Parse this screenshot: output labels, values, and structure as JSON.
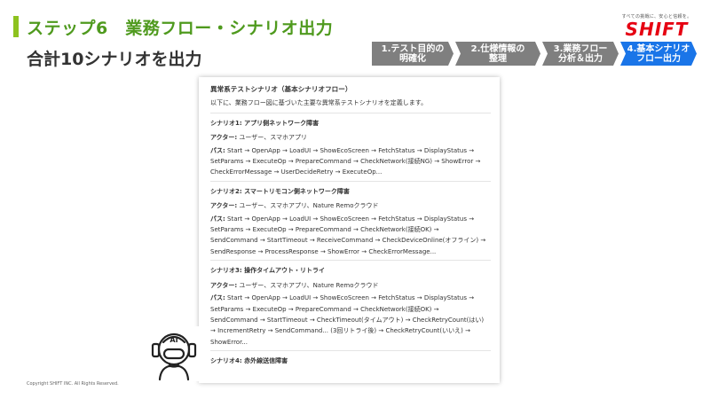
{
  "header": {
    "title": "ステップ6　業務フロー・シナリオ出力",
    "subtitle": "合計10シナリオを出力"
  },
  "logo": {
    "tagline": "すべての挑戦に、安心と信頼を。",
    "wordmark": "SHIFT"
  },
  "steps": [
    {
      "label": "1.テスト目的の\n明確化",
      "active": false
    },
    {
      "label": "2.仕様情報の\n整理",
      "active": false
    },
    {
      "label": "3.業務フロー\n分析＆出力",
      "active": false
    },
    {
      "label": "4.基本シナリオ\nフロー出力",
      "active": true
    }
  ],
  "colors": {
    "title_green": "#4f9a1e",
    "accent_green": "#8dc21f",
    "step_gray": "#7f7f7f",
    "step_active_blue": "#1a75e8",
    "logo_red": "#e60012"
  },
  "document": {
    "title": "異常系テストシナリオ（基本シナリオフロー）",
    "intro": "以下に、業務フロー図に基づいた主要な異常系テストシナリオを定義します。",
    "actor_label": "アクター:",
    "path_label": "パス:",
    "scenarios": [
      {
        "title": "シナリオ1: アプリ側ネットワーク障害",
        "actors": "ユーザー、スマホアプリ",
        "path": "Start → OpenApp → LoadUI → ShowEcoScreen → FetchStatus → DisplayStatus → SetParams → ExecuteOp → PrepareCommand → CheckNetwork(接続NG) → ShowError → CheckErrorMessage → UserDecideRetry → ExecuteOp..."
      },
      {
        "title": "シナリオ2: スマートリモコン側ネットワーク障害",
        "actors": "ユーザー、スマホアプリ、Nature Remoクラウド",
        "path": "Start → OpenApp → LoadUI → ShowEcoScreen → FetchStatus → DisplayStatus → SetParams → ExecuteOp → PrepareCommand → CheckNetwork(接続OK) → SendCommand → StartTimeout → ReceiveCommand → CheckDeviceOnline(オフライン) → SendResponse → ProcessResponse → ShowError → CheckErrorMessage..."
      },
      {
        "title": "シナリオ3: 操作タイムアウト・リトライ",
        "actors": "ユーザー、スマホアプリ、Nature Remoクラウド",
        "path": "Start → OpenApp → LoadUI → ShowEcoScreen → FetchStatus → DisplayStatus → SetParams → ExecuteOp → PrepareCommand → CheckNetwork(接続OK) → SendCommand → StartTimeout → CheckTimeout(タイムアウト) → CheckRetryCount(はい) → IncrementRetry → SendCommand... (3回リトライ後) → CheckRetryCount(いいえ) → ShowError..."
      },
      {
        "title": "シナリオ4: 赤外線送信障害",
        "actors": "",
        "path": ""
      }
    ]
  },
  "robot": {
    "badge": "AI"
  },
  "footer": {
    "copyright": "Copyright SHIFT INC. All Rights Reserved."
  }
}
